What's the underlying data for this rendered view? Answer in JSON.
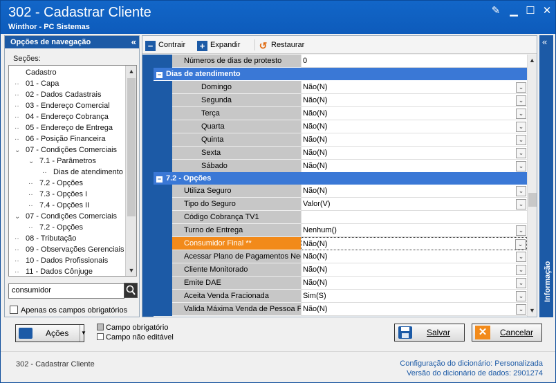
{
  "window": {
    "title": "302 - Cadastrar Cliente",
    "subtitle": "Winthor - PC Sistemas"
  },
  "nav": {
    "header": "Opções de navegação",
    "sections_label": "Seções:",
    "tree": [
      {
        "label": "Cadastro",
        "depth": 0,
        "expander": ""
      },
      {
        "label": "01 - Capa",
        "depth": 1,
        "expander": ""
      },
      {
        "label": "02 - Dados Cadastrais",
        "depth": 1,
        "expander": ""
      },
      {
        "label": "03 - Endereço Comercial",
        "depth": 1,
        "expander": ""
      },
      {
        "label": "04 - Endereço Cobrança",
        "depth": 1,
        "expander": ""
      },
      {
        "label": "05 - Endereço de Entrega",
        "depth": 1,
        "expander": ""
      },
      {
        "label": "06 - Posição Financeira",
        "depth": 1,
        "expander": ""
      },
      {
        "label": "07 - Condições Comerciais",
        "depth": 1,
        "expander": "v"
      },
      {
        "label": "7.1 - Parâmetros",
        "depth": 2,
        "expander": "v"
      },
      {
        "label": "Dias de atendimento",
        "depth": 3,
        "expander": ""
      },
      {
        "label": "7.2 - Opções",
        "depth": 2,
        "expander": ""
      },
      {
        "label": "7.3 - Opções I",
        "depth": 2,
        "expander": ""
      },
      {
        "label": "7.4 - Opções II",
        "depth": 2,
        "expander": ""
      },
      {
        "label": "07 - Condições Comerciais",
        "depth": 1,
        "expander": "v"
      },
      {
        "label": "7.2 - Opções",
        "depth": 2,
        "expander": ""
      },
      {
        "label": "08 - Tributação",
        "depth": 1,
        "expander": ""
      },
      {
        "label": "09 - Observações Gerenciais",
        "depth": 1,
        "expander": ""
      },
      {
        "label": "10 - Dados Profissionais",
        "depth": 1,
        "expander": ""
      },
      {
        "label": "11 - Dados Cônjuge",
        "depth": 1,
        "expander": ""
      }
    ],
    "search_value": "consumidor",
    "required_only_label": "Apenas os campos obrigatórios"
  },
  "toolbar": {
    "collapse": "Contrair",
    "expand": "Expandir",
    "restore": "Restaurar"
  },
  "grid": {
    "top_row": {
      "label": "Números de dias de protesto",
      "value": "0"
    },
    "group1": "Dias de atendimento",
    "days": [
      {
        "label": "Domingo",
        "value": "Não(N)"
      },
      {
        "label": "Segunda",
        "value": "Não(N)"
      },
      {
        "label": "Terça",
        "value": "Não(N)"
      },
      {
        "label": "Quarta",
        "value": "Não(N)"
      },
      {
        "label": "Quinta",
        "value": "Não(N)"
      },
      {
        "label": "Sexta",
        "value": "Não(N)"
      },
      {
        "label": "Sábado",
        "value": "Não(N)"
      }
    ],
    "group2": "7.2 - Opções",
    "options": [
      {
        "label": "Utiliza Seguro",
        "value": "Não(N)",
        "dropdown": true
      },
      {
        "label": "Tipo do Seguro",
        "value": "Valor(V)",
        "dropdown": true
      },
      {
        "label": "Código Cobrança TV1",
        "value": "",
        "dropdown": false
      },
      {
        "label": "Turno de Entrega",
        "value": "Nenhum()",
        "dropdown": true
      },
      {
        "label": "Consumidor Final **",
        "value": "Não(N)",
        "dropdown": true
      },
      {
        "label": "Acessar Plano de Pagamentos Neg",
        "value": "Não(N)",
        "dropdown": true
      },
      {
        "label": "Cliente Monitorado",
        "value": "Não(N)",
        "dropdown": true
      },
      {
        "label": "Emite DAE",
        "value": "Não(N)",
        "dropdown": true
      },
      {
        "label": "Aceita Venda Fracionada",
        "value": "Sim(S)",
        "dropdown": true
      },
      {
        "label": "Valida Máxima Venda de Pessoa Fís",
        "value": "Não(N)",
        "dropdown": true
      }
    ]
  },
  "info_label": "Informação",
  "bottom": {
    "actions": "Ações",
    "legend_required": "Campo obrigatório",
    "legend_readonly": "Campo não editável",
    "save": "Salvar",
    "cancel": "Cancelar"
  },
  "footer": {
    "left": "302 - Cadastrar Cliente",
    "dict_config_label": "Configuração do dicionário:",
    "dict_config_value": "Personalizada",
    "dict_version_label": "Versão do dicionário de dados:",
    "dict_version_value": "2901274"
  },
  "colors": {
    "title_bar": "#1266c8",
    "accent_blue": "#1c5aa6",
    "highlight_orange": "#f28a1a",
    "save_icon": "#1c5aa6",
    "cancel_icon": "#e06a10"
  }
}
